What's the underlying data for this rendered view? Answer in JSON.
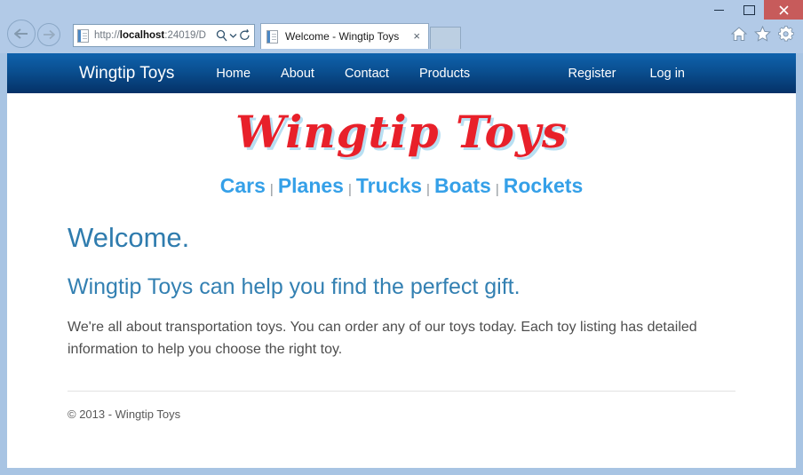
{
  "browser": {
    "back_label": "Back",
    "forward_label": "Forward",
    "url": "http://localhost:24019/D",
    "url_bold_part": "localhost",
    "url_prefix": "http://",
    "url_suffix": ":24019/D",
    "search_icon": "magnifier-icon",
    "dropdown_icon": "chevron-down-icon",
    "refresh_icon": "refresh-icon",
    "favicon_icon": "page-favicon-icon",
    "tab": {
      "title": "Welcome - Wingtip Toys",
      "close_label": "×"
    },
    "new_tab_label": "",
    "toolbar_icons": [
      "home-icon",
      "favorites-star-icon",
      "settings-gear-icon"
    ],
    "window_controls": {
      "minimize": "–",
      "maximize": "□",
      "close": "×"
    }
  },
  "site": {
    "brand": "Wingtip Toys",
    "nav_items": [
      {
        "label": "Home"
      },
      {
        "label": "About"
      },
      {
        "label": "Contact"
      },
      {
        "label": "Products"
      }
    ],
    "account_items": [
      {
        "label": "Register"
      },
      {
        "label": "Log in"
      }
    ],
    "logo_text": "Wingtip Toys",
    "categories": [
      {
        "label": "Cars"
      },
      {
        "label": "Planes"
      },
      {
        "label": "Trucks"
      },
      {
        "label": "Boats"
      },
      {
        "label": "Rockets"
      }
    ],
    "category_separator": "|",
    "heading": "Welcome.",
    "tagline": "Wingtip Toys can help you find the perfect gift.",
    "paragraph": "We're all about transportation toys. You can order any of our toys today. Each toy listing has detailed information to help you choose the right toy.",
    "footer": "© 2013 - Wingtip Toys"
  },
  "colors": {
    "nav_top": "#0f62ad",
    "nav_bottom": "#053167",
    "logo_red": "#e8202a",
    "logo_shadow": "#b8dff2",
    "category_blue": "#35a0e8",
    "heading_blue": "#2f7cae",
    "window_frame": "#a8c4e3",
    "close_button": "#c75b5b"
  }
}
